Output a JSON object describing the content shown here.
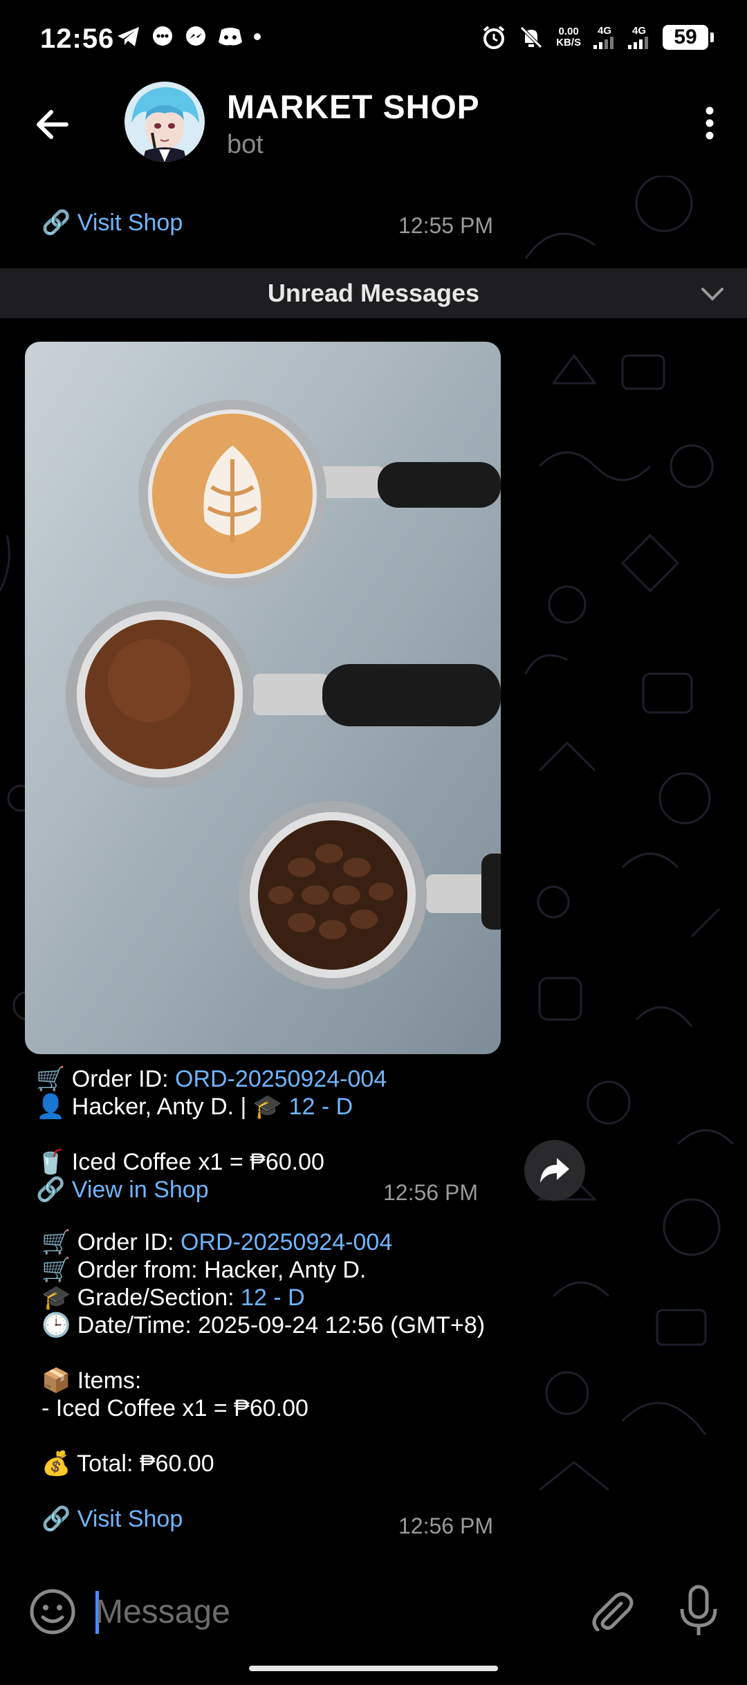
{
  "status_bar": {
    "time": "12:56",
    "net_speed": "0.00",
    "net_unit": "KB/S",
    "sim1": "4G",
    "sim2": "4G",
    "battery": "59"
  },
  "header": {
    "title": "MARKET SHOP",
    "subtitle": "bot"
  },
  "previous_message": {
    "link_label": "Visit Shop",
    "time": "12:55 PM"
  },
  "unread_banner": "Unread Messages",
  "photo_message": {
    "lines": {
      "order_label": "Order ID: ",
      "order_id": "ORD-20250924-004",
      "customer": "Hacker, Anty D. | ",
      "grade": "12 - D",
      "item": "Iced Coffee x1 = ₱60.00",
      "link_label": "View in Shop"
    },
    "time": "12:56 PM"
  },
  "order_message": {
    "order_label": "Order ID: ",
    "order_id": "ORD-20250924-004",
    "order_from": "Order from: Hacker, Anty D.",
    "grade_label": "Grade/Section: ",
    "grade": "12 - D",
    "datetime": "Date/Time: 2025-09-24 12:56 (GMT+8)",
    "items_label": "Items:",
    "item_line": "- Iced Coffee x1 = ₱60.00",
    "total": "Total: ₱60.00",
    "link_label": "Visit Shop",
    "time": "12:56 PM"
  },
  "input": {
    "placeholder": "Message"
  },
  "colors": {
    "link": "#6fb5ff",
    "background": "#000000",
    "banner": "#1e1e20"
  }
}
